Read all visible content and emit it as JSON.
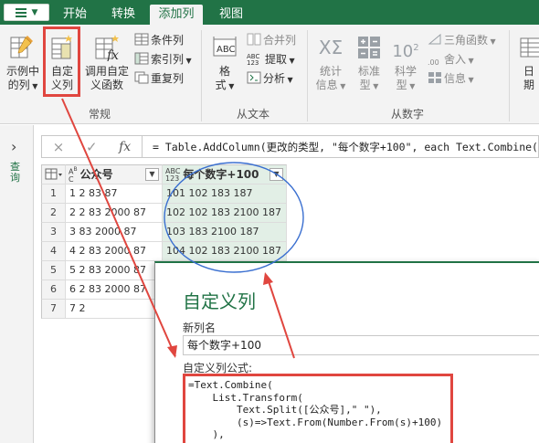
{
  "tabs": [
    {
      "label": "开始",
      "active": false
    },
    {
      "label": "转换",
      "active": false
    },
    {
      "label": "添加列",
      "active": true
    },
    {
      "label": "视图",
      "active": false
    }
  ],
  "ribbon": {
    "examples_col_line1": "示例中",
    "examples_col_line2": "的列",
    "custom_col_line1": "自定",
    "custom_col_line2": "义列",
    "invoke_fn_line1": "调用自定",
    "invoke_fn_line2": "义函数",
    "conditional_col": "条件列",
    "index_col": "索引列",
    "duplicate_col": "重复列",
    "format_line1": "格",
    "format_line2": "式",
    "merge_cols": "合并列",
    "extract": "提取",
    "parse": "分析",
    "statistics_line1": "统计",
    "statistics_line2": "信息",
    "standard_line1": "标准",
    "standard_line2": "型",
    "scientific_line1": "科学",
    "scientific_line2": "型",
    "trig": "三角函数",
    "rounding": "舍入",
    "information": "信息",
    "date_line1": "日",
    "date_line2": "期",
    "group_general": "常规",
    "group_from_text": "从文本",
    "group_from_number": "从数字",
    "icon_10_label": "10",
    "icon_abc_label": "ABC",
    "icon_abc123_top": "ABC",
    "icon_abc123_bottom": "123"
  },
  "left_pane": {
    "label": "查询"
  },
  "formula_bar": {
    "cancel_icon": "×",
    "confirm_icon": "✓",
    "fx_icon": "fx",
    "formula": "= Table.AddColumn(更改的类型, \"每个数字+100\", each Text.Combine("
  },
  "table": {
    "columns": [
      {
        "type_top": "A",
        "type_bottom": "B",
        "type_c": "C",
        "name": "公众号"
      },
      {
        "type_top": "ABC",
        "type_bottom": "123",
        "name": "每个数字+100"
      }
    ],
    "rows": [
      {
        "num": "1",
        "col1": "1 2 83 87",
        "col2": "101 102 183 187"
      },
      {
        "num": "2",
        "col1": "2 2 83 2000 87",
        "col2": "102 102 183 2100 187"
      },
      {
        "num": "3",
        "col1": "3 83 2000 87",
        "col2": "103 183 2100 187"
      },
      {
        "num": "4",
        "col1": "4 2 83 2000 87",
        "col2": "104 102 183 2100 187"
      },
      {
        "num": "5",
        "col1": "5 2 83 2000 87",
        "col2": ""
      },
      {
        "num": "6",
        "col1": "6 2 83 2000 87",
        "col2": ""
      },
      {
        "num": "7",
        "col1": "7 2",
        "col2": ""
      }
    ]
  },
  "dialog": {
    "title": "自定义列",
    "new_col_label": "新列名",
    "new_col_value": "每个数字+100",
    "formula_label": "自定义列公式:",
    "code": "=Text.Combine(\n    List.Transform(\n        Text.Split([公众号],\" \"),\n        (s)=>Text.From(Number.From(s)+100)\n    ),"
  },
  "colors": {
    "accent": "#217346",
    "annotation": "#e0463f",
    "ellipse": "#3a6fd0",
    "new_col_bg": "#e2efe6"
  }
}
